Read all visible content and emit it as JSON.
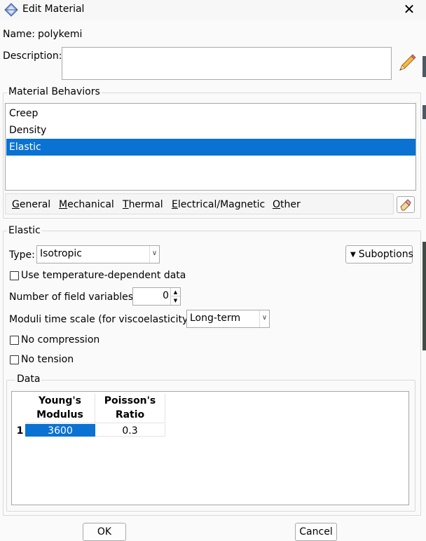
{
  "window": {
    "title": "Edit Material",
    "close_icon": "✕"
  },
  "name": {
    "label": "Name:",
    "value": "polykemi"
  },
  "description": {
    "label": "Description:",
    "value": ""
  },
  "behaviors": {
    "group_label": "Material Behaviors",
    "items": [
      {
        "label": "Creep"
      },
      {
        "label": "Density"
      },
      {
        "label": "Elastic"
      }
    ],
    "selected_index": 2,
    "selected_color": "#0a72d3"
  },
  "menu": {
    "general": {
      "first": "G",
      "rest": "eneral"
    },
    "mechanical": {
      "first": "M",
      "rest": "echanical"
    },
    "thermal": {
      "first": "T",
      "rest": "hermal"
    },
    "electrical": {
      "first": "E",
      "rest": "lectrical/Magnetic"
    },
    "other": {
      "first": "O",
      "rest": "ther"
    }
  },
  "elastic": {
    "group_label": "Elastic",
    "type_label": "Type:",
    "type_value": "Isotropic",
    "suboptions_label": "Suboptions",
    "temp_dependent_label": "Use temperature-dependent data",
    "field_vars_label": "Number of field variables:",
    "field_vars_value": "0",
    "moduli_label": "Moduli time scale (for viscoelasticity):",
    "moduli_value": "Long-term",
    "no_compression_label": "No compression",
    "no_tension_label": "No tension"
  },
  "data_table": {
    "group_label": "Data",
    "columns": [
      {
        "line1": "Young's",
        "line2": "Modulus"
      },
      {
        "line1": "Poisson's",
        "line2": "Ratio"
      }
    ],
    "rows": [
      {
        "index": "1",
        "cells": [
          "3600",
          "0.3"
        ]
      }
    ]
  },
  "buttons": {
    "ok": "OK",
    "cancel": "Cancel"
  }
}
